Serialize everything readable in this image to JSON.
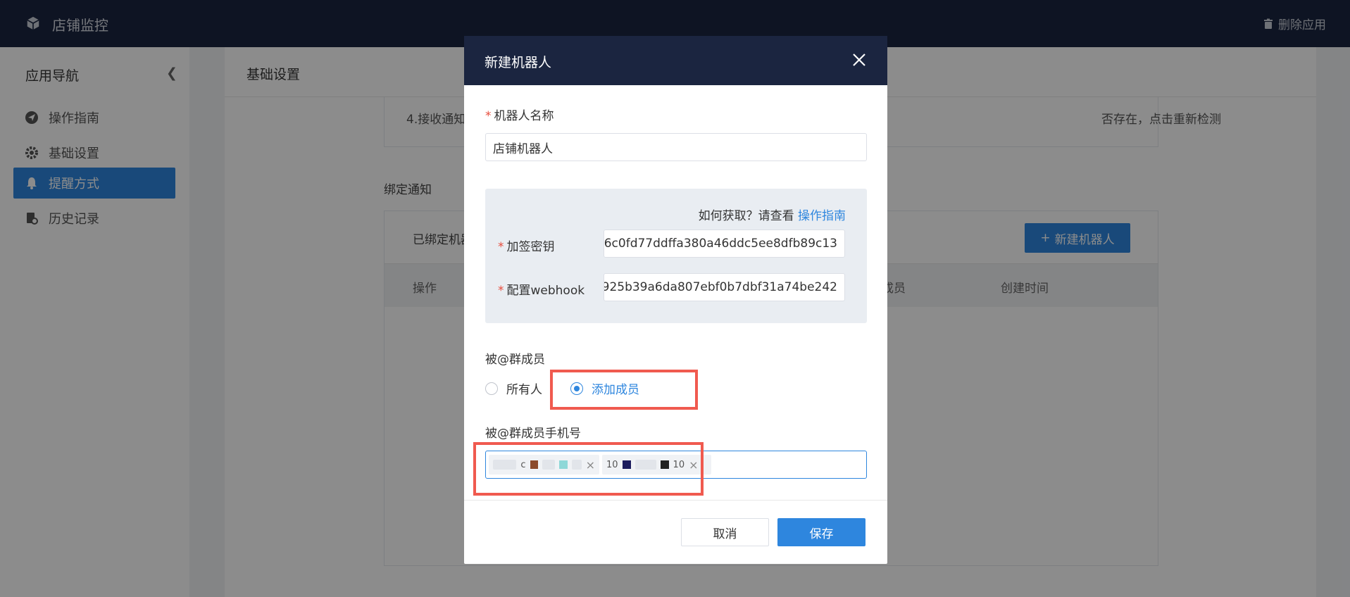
{
  "header": {
    "app_title": "店铺监控",
    "delete_app": "删除应用"
  },
  "sidebar": {
    "title": "应用导航",
    "collapse_icon": "chevron-left-icon",
    "items": [
      {
        "label": "操作指南",
        "icon": "paper-plane-icon",
        "active": false
      },
      {
        "label": "基础设置",
        "icon": "gear-icon",
        "active": false
      },
      {
        "label": "提醒方式",
        "icon": "bell-icon",
        "active": true
      },
      {
        "label": "历史记录",
        "icon": "history-icon",
        "active": false
      }
    ]
  },
  "main": {
    "section_title": "基础设置",
    "notice_left": "4.接收通知",
    "notice_right": "否存在，点击重新检测",
    "bind_title": "绑定通知",
    "bound_label": "已绑定机器",
    "new_robot_button": "新建机器人",
    "table_headers": [
      "操作",
      "成员",
      "创建时间"
    ]
  },
  "modal": {
    "title": "新建机器人",
    "robot_name_label": "机器人名称",
    "robot_name_value": "店铺机器人",
    "how_to_get": "如何获取？请查看",
    "guide_link": "操作指南",
    "secret_label": "加签密钥",
    "secret_value": "6c0fd77ddffa380a46ddc5ee8dfb89c13",
    "webhook_label": "配置webhook",
    "webhook_value": "925b39a6da807ebf0b7dbf31a74be242",
    "mention_label": "被@群成员",
    "radio_all": "所有人",
    "radio_add": "添加成员",
    "phone_label": "被@群成员手机号",
    "tags": [
      {
        "visible_text": "c",
        "swatch_colors": [
          "#8b4a2b",
          "#8fd8d8"
        ]
      },
      {
        "visible_text": "10",
        "swatch_colors": [
          "#1c1c5e",
          "#222222"
        ]
      }
    ],
    "tag_extra_text": "10",
    "cancel_button": "取消",
    "save_button": "保存"
  },
  "colors": {
    "topbar": "#1b2540",
    "accent": "#2e86de",
    "highlight": "#f05a4f"
  }
}
